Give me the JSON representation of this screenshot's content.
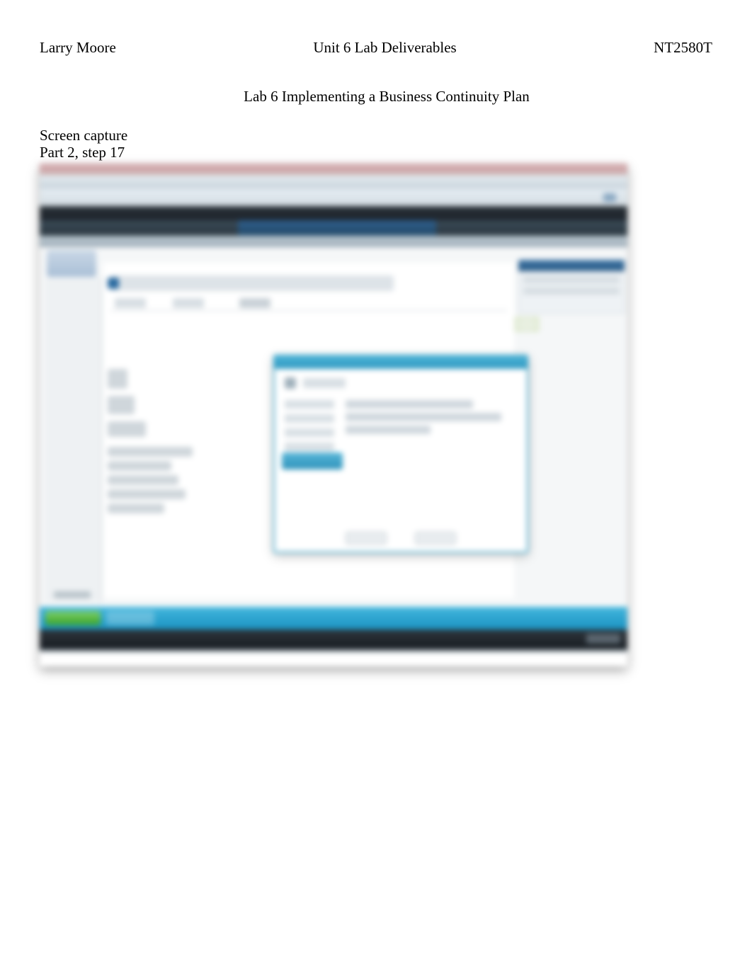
{
  "header": {
    "left": "Larry Moore",
    "center": "Unit 6 Lab Deliverables",
    "right": "NT2580T"
  },
  "title": "Lab 6 Implementing a Business Continuity Plan",
  "caption": {
    "line1": "Screen capture",
    "line2": "Part 2, step 17"
  }
}
